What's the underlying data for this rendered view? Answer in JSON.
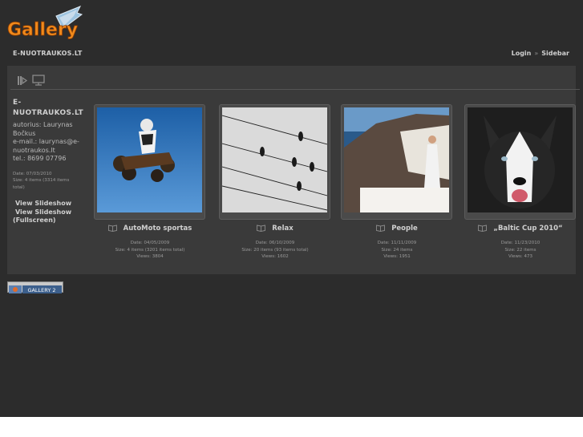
{
  "header": {
    "logo_text": "Gallery",
    "site_title": "E-NUOTRAUKOS.LT",
    "links": {
      "login": "Login",
      "separator": "»",
      "sidebar": "Sidebar"
    }
  },
  "toolbar": {
    "icons": [
      "slideshow-icon",
      "presentation-icon"
    ]
  },
  "sidebar": {
    "title_line1": "E-",
    "title_line2": "NUOTRAUKOS.LT",
    "desc_line1": "autorius: Laurynas",
    "desc_line2": "Bočkus",
    "desc_line3": "e-mail.: laurynas@e-",
    "desc_line4": "nuotraukos.lt",
    "desc_line5": "tel.: 8699 07796",
    "date": "Date: 07/03/2010",
    "size_line1": "Size: 4 items (3314 items",
    "size_line2": "total)",
    "action_slideshow": "View Slideshow",
    "action_fullscreen_line1": "View Slideshow",
    "action_fullscreen_line2": "(Fullscreen)"
  },
  "albums": [
    {
      "title": "AutoMoto sportas",
      "date": "Date: 04/05/2009",
      "size": "Size: 4 items (3201 items total)",
      "views": "Views: 3804"
    },
    {
      "title": "Relax",
      "date": "Date: 06/10/2009",
      "size": "Size: 20 items (93 items total)",
      "views": "Views: 1602"
    },
    {
      "title": "People",
      "date": "Date: 11/11/2009",
      "size": "Size: 24 items",
      "views": "Views: 1951"
    },
    {
      "title": "„Baltic Cup 2010“",
      "date": "Date: 11/23/2010",
      "size": "Size: 22 items",
      "views": "Views: 473"
    }
  ],
  "footer": {
    "badge_text": "GALLERY 2"
  },
  "colors": {
    "page_bg": "#2c2c2c",
    "panel_bg": "#3a3a3a",
    "logo_orange": "#f08a1c"
  }
}
